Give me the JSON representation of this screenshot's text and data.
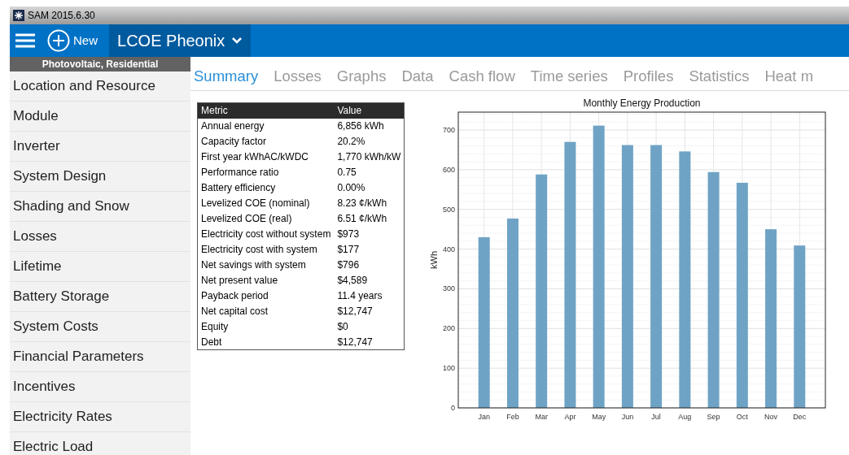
{
  "window": {
    "title": "SAM 2015.6.30"
  },
  "toolbar": {
    "new_label": "New",
    "project": "LCOE Pheonix"
  },
  "sidebar": {
    "header": "Photovoltaic, Residential",
    "items": [
      {
        "label": "Location and Resource",
        "selected": false
      },
      {
        "label": "Module",
        "selected": false
      },
      {
        "label": "Inverter",
        "selected": false
      },
      {
        "label": "System Design",
        "selected": false
      },
      {
        "label": "Shading and Snow",
        "selected": false
      },
      {
        "label": "Losses",
        "selected": false
      },
      {
        "label": "Lifetime",
        "selected": false
      },
      {
        "label": "Battery Storage",
        "selected": false
      },
      {
        "label": "System Costs",
        "selected": false
      },
      {
        "label": "Financial Parameters",
        "selected": false
      },
      {
        "label": "Incentives",
        "selected": false
      },
      {
        "label": "Electricity Rates",
        "selected": false
      },
      {
        "label": "Electric Load",
        "selected": false
      }
    ]
  },
  "tabs": [
    {
      "label": "Summary",
      "selected": true
    },
    {
      "label": "Losses",
      "selected": false
    },
    {
      "label": "Graphs",
      "selected": false
    },
    {
      "label": "Data",
      "selected": false
    },
    {
      "label": "Cash flow",
      "selected": false
    },
    {
      "label": "Time series",
      "selected": false
    },
    {
      "label": "Profiles",
      "selected": false
    },
    {
      "label": "Statistics",
      "selected": false
    },
    {
      "label": "Heat m",
      "selected": false
    }
  ],
  "table": {
    "columns": [
      "Metric",
      "Value"
    ],
    "rows": [
      [
        "Annual energy",
        "6,856 kWh"
      ],
      [
        "Capacity factor",
        "20.2%"
      ],
      [
        "First year kWhAC/kWDC",
        "1,770 kWh/kW"
      ],
      [
        "Performance ratio",
        "0.75"
      ],
      [
        "Battery efficiency",
        "0.00%"
      ],
      [
        "Levelized COE (nominal)",
        "8.23 ¢/kWh"
      ],
      [
        "Levelized COE (real)",
        "6.51 ¢/kWh"
      ],
      [
        "Electricity cost without system",
        "$973"
      ],
      [
        "Electricity cost with system",
        "$177"
      ],
      [
        "Net savings with system",
        "$796"
      ],
      [
        "Net present value",
        "$4,589"
      ],
      [
        "Payback period",
        "11.4 years"
      ],
      [
        "Net capital cost",
        "$12,747"
      ],
      [
        "Equity",
        "$0"
      ],
      [
        "Debt",
        "$12,747"
      ]
    ]
  },
  "chart": {
    "chart_data": {
      "type": "bar",
      "title": "Monthly Energy Production",
      "ylabel": "kWh",
      "categories": [
        "Jan",
        "Feb",
        "Mar",
        "Apr",
        "May",
        "Jun",
        "Jul",
        "Aug",
        "Sep",
        "Oct",
        "Nov",
        "Dec"
      ],
      "grid": true,
      "series": [
        {
          "color": "#6fa3c5",
          "values": [
            430,
            477,
            588,
            670,
            711,
            662,
            662,
            646,
            594,
            567,
            450,
            409
          ]
        }
      ],
      "ylim": [
        0,
        745
      ],
      "yticks": [
        0,
        100,
        200,
        300,
        400,
        500,
        600,
        700
      ]
    }
  }
}
